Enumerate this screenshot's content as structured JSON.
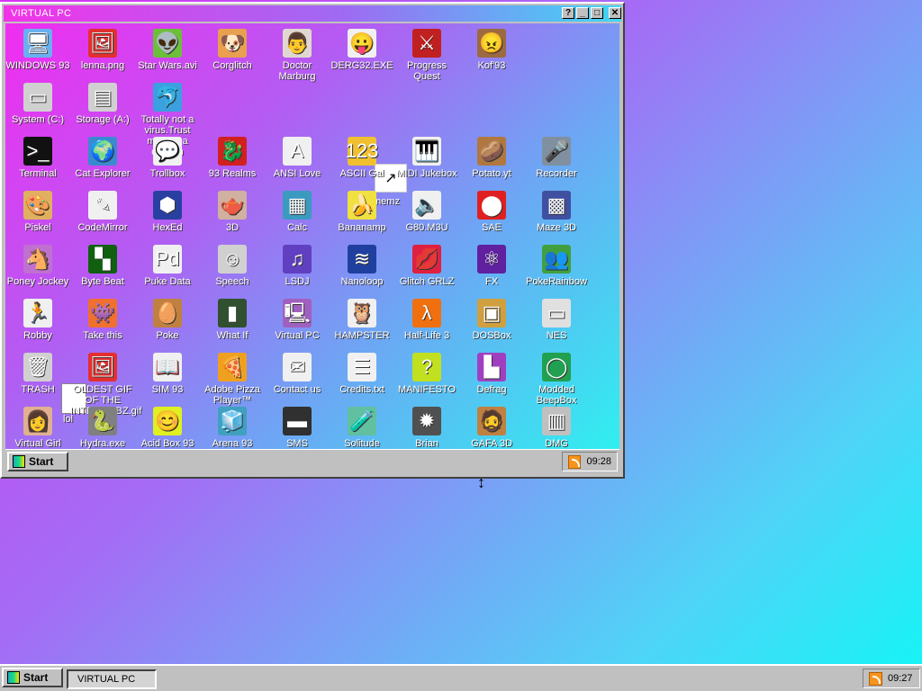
{
  "window": {
    "title": "VIRTUAL PC",
    "help": "?",
    "minimize": "_",
    "maximize": "□",
    "close": "✕"
  },
  "icons": [
    {
      "label": "WINDOWS 93",
      "glyph": "🖥",
      "bg": "#6ab0f0"
    },
    {
      "label": "lenna.png",
      "glyph": "🖼",
      "bg": "#e23030"
    },
    {
      "label": "Star Wars.avi",
      "glyph": "👽",
      "bg": "#6cbf3a"
    },
    {
      "label": "Corglitch",
      "glyph": "🐶",
      "bg": "#e8a050"
    },
    {
      "label": "Doctor Marburg",
      "glyph": "👨",
      "bg": "#e0d8d0"
    },
    {
      "label": "DERG32.EXE",
      "glyph": "😛",
      "bg": "#f0f0f0"
    },
    {
      "label": "Progress Quest",
      "glyph": "⚔",
      "bg": "#c02020"
    },
    {
      "label": "Kof'93",
      "glyph": "😠",
      "bg": "#9c6a40"
    },
    {
      "label": "System (C:)",
      "glyph": "▭",
      "bg": "#d0d0d0"
    },
    {
      "label": "Storage (A:)",
      "glyph": "▤",
      "bg": "#d0d0d0"
    },
    {
      "label": "Totally not a virus.Trust me...im a dolphin",
      "glyph": "🐬",
      "bg": "#3aa0e0"
    },
    {
      "label": "Terminal",
      "glyph": ">_",
      "bg": "#111111"
    },
    {
      "label": "Cat Explorer",
      "glyph": "🌍",
      "bg": "#3a8ad0"
    },
    {
      "label": "Trollbox",
      "glyph": "💬",
      "bg": "#f0f0f0"
    },
    {
      "label": "93 Realms",
      "glyph": "🐉",
      "bg": "#d02020"
    },
    {
      "label": "ANSI Love",
      "glyph": "A",
      "bg": "#f0f0f0"
    },
    {
      "label": "ASCII Gal",
      "glyph": "123",
      "bg": "#f0c030"
    },
    {
      "label": "MIDI Jukebox",
      "glyph": "🎹",
      "bg": "#f0f0f0"
    },
    {
      "label": "Potato.yt",
      "glyph": "🥔",
      "bg": "#b07840"
    },
    {
      "label": "Recorder",
      "glyph": "🎤",
      "bg": "#8090a0"
    },
    {
      "label": "Piskel",
      "glyph": "🎨",
      "bg": "#e0b060"
    },
    {
      "label": "CodeMirror",
      "glyph": "✎",
      "bg": "#f0f0f0"
    },
    {
      "label": "HexEd",
      "glyph": "⬢",
      "bg": "#2a40a0"
    },
    {
      "label": "3D",
      "glyph": "🫖",
      "bg": "#d0b0a0"
    },
    {
      "label": "Calc",
      "glyph": "▦",
      "bg": "#3a9ac0"
    },
    {
      "label": "Bananamp",
      "glyph": "🍌",
      "bg": "#f0e040"
    },
    {
      "label": "G80.M3U",
      "glyph": "🔈",
      "bg": "#f0f0f0"
    },
    {
      "label": "SAE",
      "glyph": "⬤",
      "bg": "#e02020"
    },
    {
      "label": "Maze 3D",
      "glyph": "▩",
      "bg": "#4050a0"
    },
    {
      "label": "Poney Jockey",
      "glyph": "🐴",
      "bg": "#c070d0"
    },
    {
      "label": "Byte Beat",
      "glyph": "▚",
      "bg": "#106010"
    },
    {
      "label": "Puke Data",
      "glyph": "Pd",
      "bg": "#f0f0f0"
    },
    {
      "label": "Speech",
      "glyph": "☺",
      "bg": "#d0d0d0"
    },
    {
      "label": "LSDJ",
      "glyph": "♫",
      "bg": "#6040c0"
    },
    {
      "label": "Nanoloop",
      "glyph": "≋",
      "bg": "#2040a0"
    },
    {
      "label": "Glitch GRLZ",
      "glyph": "💋",
      "bg": "#e02040"
    },
    {
      "label": "FX",
      "glyph": "⚛",
      "bg": "#6020a0"
    },
    {
      "label": "PokeRainbow",
      "glyph": "👥",
      "bg": "#40a040"
    },
    {
      "label": "Robby",
      "glyph": "🏃",
      "bg": "#f0f0f0"
    },
    {
      "label": "Take this",
      "glyph": "👾",
      "bg": "#f07030"
    },
    {
      "label": "Poke",
      "glyph": "🥚",
      "bg": "#c08040"
    },
    {
      "label": "What If",
      "glyph": "▮",
      "bg": "#305030"
    },
    {
      "label": "Virtual PC",
      "glyph": "🖳",
      "bg": "#a060c0"
    },
    {
      "label": "HAMPSTER",
      "glyph": "🦉",
      "bg": "#f0f0f0"
    },
    {
      "label": "Half-Life 3",
      "glyph": "λ",
      "bg": "#f07010"
    },
    {
      "label": "DOSBox",
      "glyph": "▣",
      "bg": "#d0a040"
    },
    {
      "label": "NES",
      "glyph": "▭",
      "bg": "#e0e0e0"
    },
    {
      "label": "TRASH",
      "glyph": "🗑",
      "bg": "#d0d0d0"
    },
    {
      "label": "OLDEST GIF OF THE INTERWEBZ.gif",
      "glyph": "🖼",
      "bg": "#e23030"
    },
    {
      "label": "SIM 93",
      "glyph": "📖",
      "bg": "#f0f0f0"
    },
    {
      "label": "Adobe Pizza Player™",
      "glyph": "🍕",
      "bg": "#f0a020"
    },
    {
      "label": "Contact us",
      "glyph": "✉",
      "bg": "#f0f0f0"
    },
    {
      "label": "Credits.txt",
      "glyph": "☰",
      "bg": "#f0f0f0"
    },
    {
      "label": "MANIFESTO",
      "glyph": "?",
      "bg": "#c0e020"
    },
    {
      "label": "Defrag",
      "glyph": "▙",
      "bg": "#a040c0"
    },
    {
      "label": "Modded BeepBox",
      "glyph": "◯",
      "bg": "#20a050"
    },
    {
      "label": "Virtual Girl",
      "glyph": "👩",
      "bg": "#e0b090"
    },
    {
      "label": "Hydra.exe",
      "glyph": "🐍",
      "bg": "#808080"
    },
    {
      "label": "Acid Box 93",
      "glyph": "😊",
      "bg": "#e0f020"
    },
    {
      "label": "Arena 93",
      "glyph": "🧊",
      "bg": "#40a0c0"
    },
    {
      "label": "SMS",
      "glyph": "▬",
      "bg": "#303030"
    },
    {
      "label": "Solitude",
      "glyph": "🧪",
      "bg": "#60c0a0"
    },
    {
      "label": "Brian",
      "glyph": "✹",
      "bg": "#505050"
    },
    {
      "label": "GAFA 3D",
      "glyph": "🧔",
      "bg": "#c08040"
    },
    {
      "label": "DMG",
      "glyph": "▥",
      "bg": "#c0c0c0"
    }
  ],
  "drag": {
    "label": "memz",
    "glyph": "↗"
  },
  "lol": {
    "label": "lol"
  },
  "inner_taskbar": {
    "start": "Start",
    "time": "09:28"
  },
  "taskbar": {
    "start": "Start",
    "task": "VIRTUAL PC",
    "time": "09:27"
  }
}
